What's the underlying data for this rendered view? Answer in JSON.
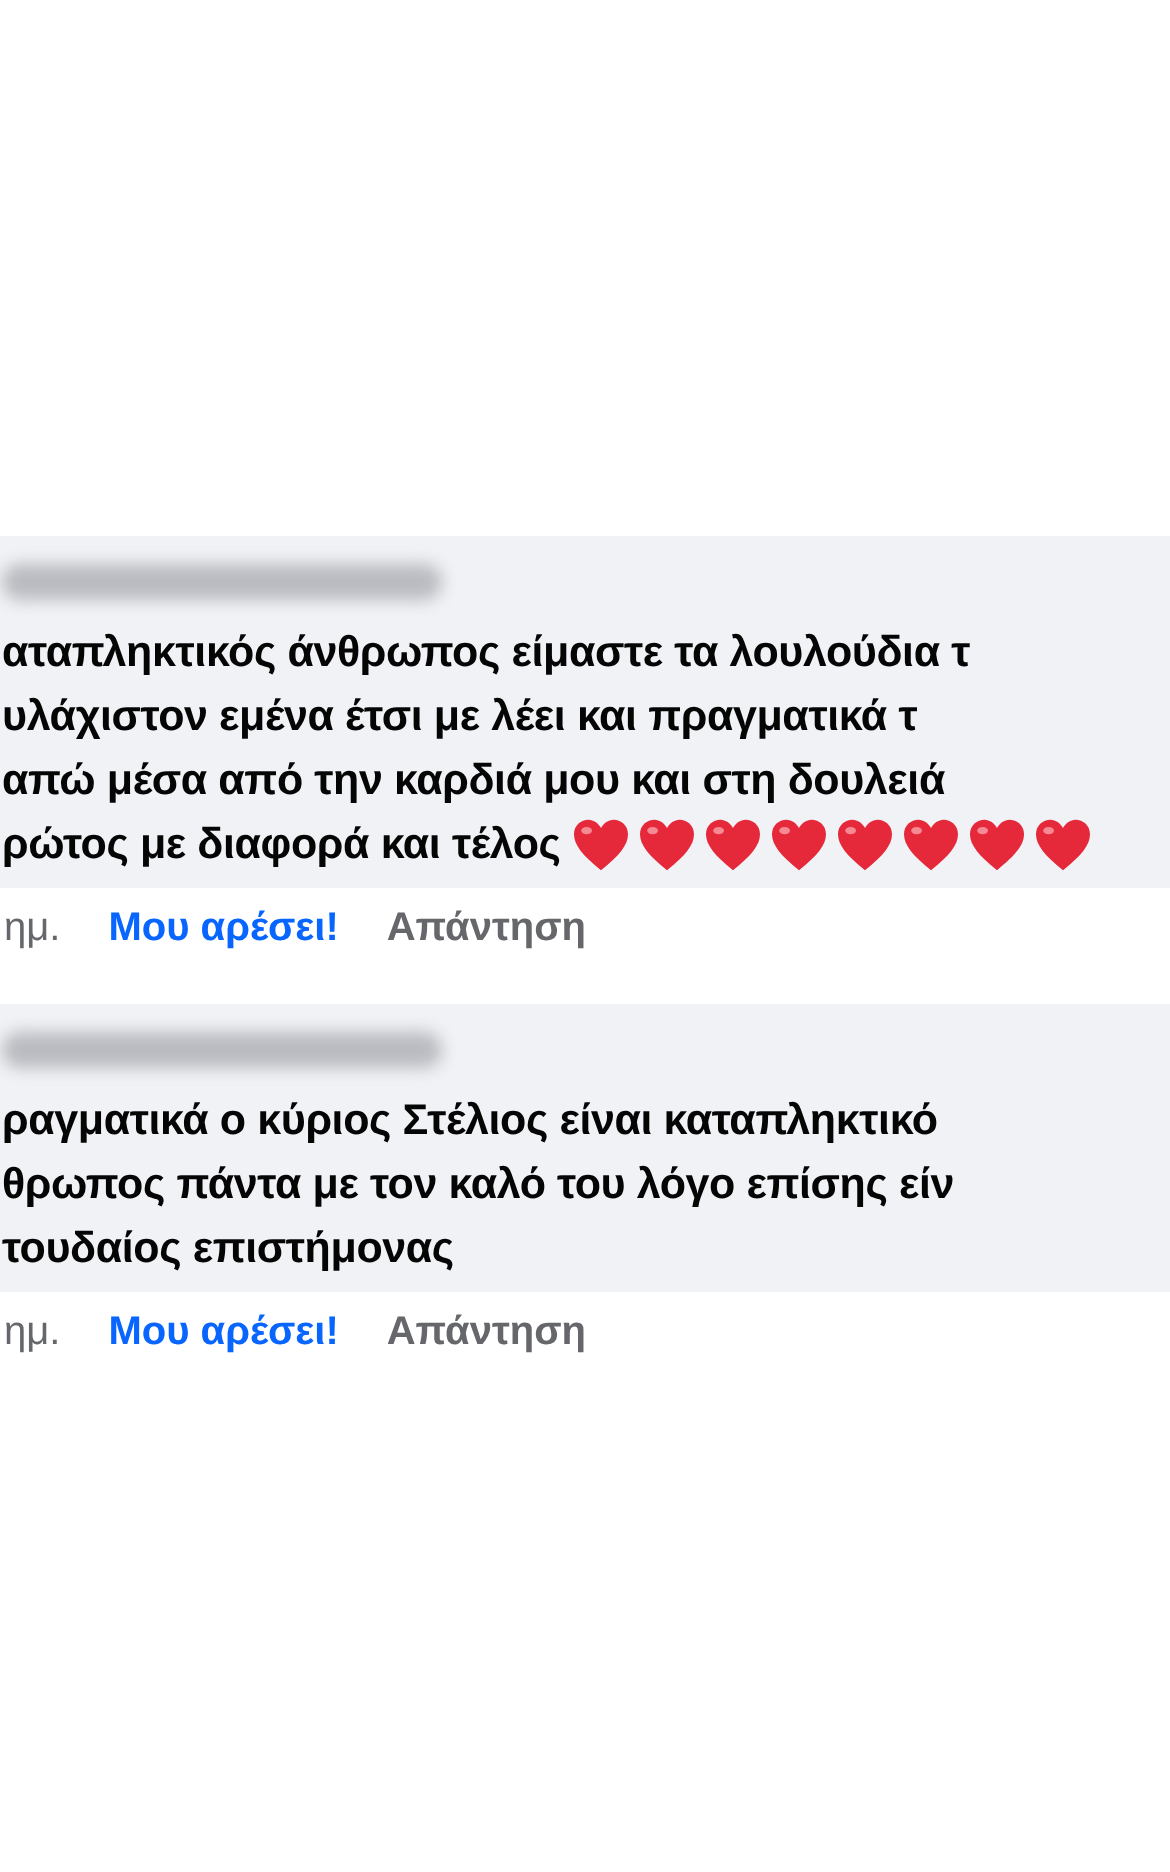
{
  "comments": [
    {
      "lines": [
        "αταπληκτικός άνθρωπος είμαστε τα λουλούδια τ",
        "υλάχιστον εμένα έτσι με λέει και πραγματικά τ",
        "απώ μέσα από την καρδιά μου και στη δουλειά",
        "ρώτος με διαφορά και τέλος"
      ],
      "emojis": [
        {
          "kind": "heart"
        },
        {
          "kind": "heart"
        },
        {
          "kind": "heart"
        },
        {
          "kind": "heart"
        },
        {
          "kind": "heart"
        },
        {
          "kind": "heart"
        },
        {
          "kind": "heart"
        },
        {
          "kind": "heart"
        }
      ],
      "time": "ημ.",
      "like": "Μου αρέσει!",
      "liked": true,
      "reply": "Απάντηση"
    },
    {
      "lines": [
        "ραγματικά ο κύριος Στέλιος είναι καταπληκτικό",
        "θρωπος πάντα με τον καλό του λόγο επίσης είν",
        "τουδαίος επιστήμονας"
      ],
      "time": "ημ.",
      "like": "Μου αρέσει!",
      "liked": true,
      "reply": "Απάντηση"
    }
  ]
}
